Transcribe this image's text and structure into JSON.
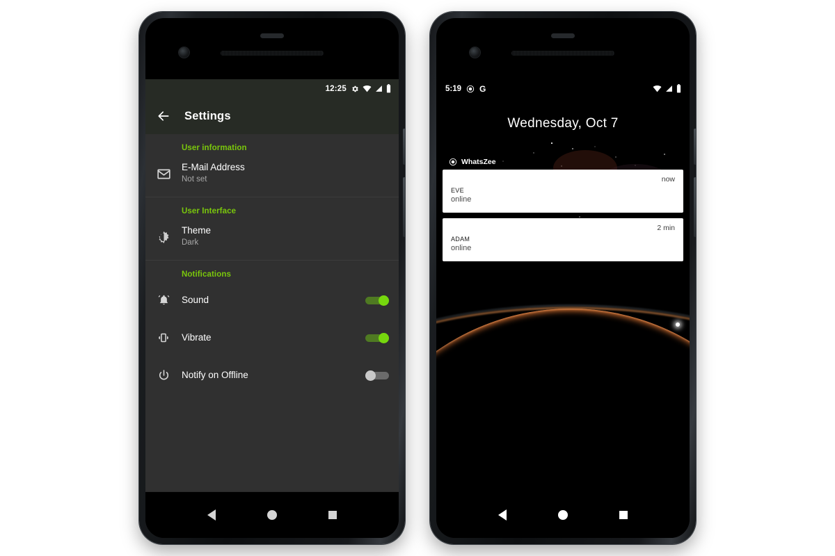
{
  "page": {
    "background_color": "#ffffff",
    "accent_green": "#7ac70c",
    "toggle_on_color": "#76d70e",
    "toggle_off_color": "#c9c9c9"
  },
  "left_phone": {
    "name": "settings-phone",
    "status_bar": {
      "time": "12:25",
      "icons": [
        "gear-icon",
        "wifi-icon",
        "signal-icon",
        "battery-icon"
      ]
    },
    "app_bar": {
      "back_label": "back-arrow",
      "title": "Settings"
    },
    "sections": [
      {
        "title": "User information",
        "rows": [
          {
            "icon": "envelope-icon",
            "title": "E-Mail Address",
            "subtitle": "Not set",
            "control": "none"
          }
        ]
      },
      {
        "title": "User Interface",
        "rows": [
          {
            "icon": "brightness-icon",
            "title": "Theme",
            "subtitle": "Dark",
            "control": "none"
          }
        ]
      },
      {
        "title": "Notifications",
        "rows": [
          {
            "icon": "bell-icon",
            "title": "Sound",
            "subtitle": "",
            "control": "switch",
            "switch_state": "on"
          },
          {
            "icon": "vibrate-icon",
            "title": "Vibrate",
            "subtitle": "",
            "control": "switch",
            "switch_state": "on"
          },
          {
            "icon": "power-icon",
            "title": "Notify on Offline",
            "subtitle": "",
            "control": "switch",
            "switch_state": "off"
          }
        ]
      }
    ],
    "nav_bar": {
      "back": "back-triangle",
      "home": "home-circle",
      "recents": "recents-square"
    }
  },
  "right_phone": {
    "name": "lockscreen-phone",
    "status_bar": {
      "time": "5:19",
      "left_icons": [
        "whatszee-icon",
        "google-g-icon"
      ],
      "right_icons": [
        "wifi-icon",
        "signal-icon",
        "battery-icon"
      ]
    },
    "lock_date": "Wednesday, Oct 7",
    "notification_group": {
      "app_name": "WhatsZee",
      "app_icon": "whatszee-icon",
      "notifications": [
        {
          "name": "Eve",
          "status": "online",
          "time": "now"
        },
        {
          "name": "Adam",
          "status": "online",
          "time": "2 min"
        }
      ]
    },
    "wallpaper": "space-planet-limb",
    "nav_bar": {
      "back": "back-triangle",
      "home": "home-circle",
      "recents": "recents-square"
    }
  }
}
